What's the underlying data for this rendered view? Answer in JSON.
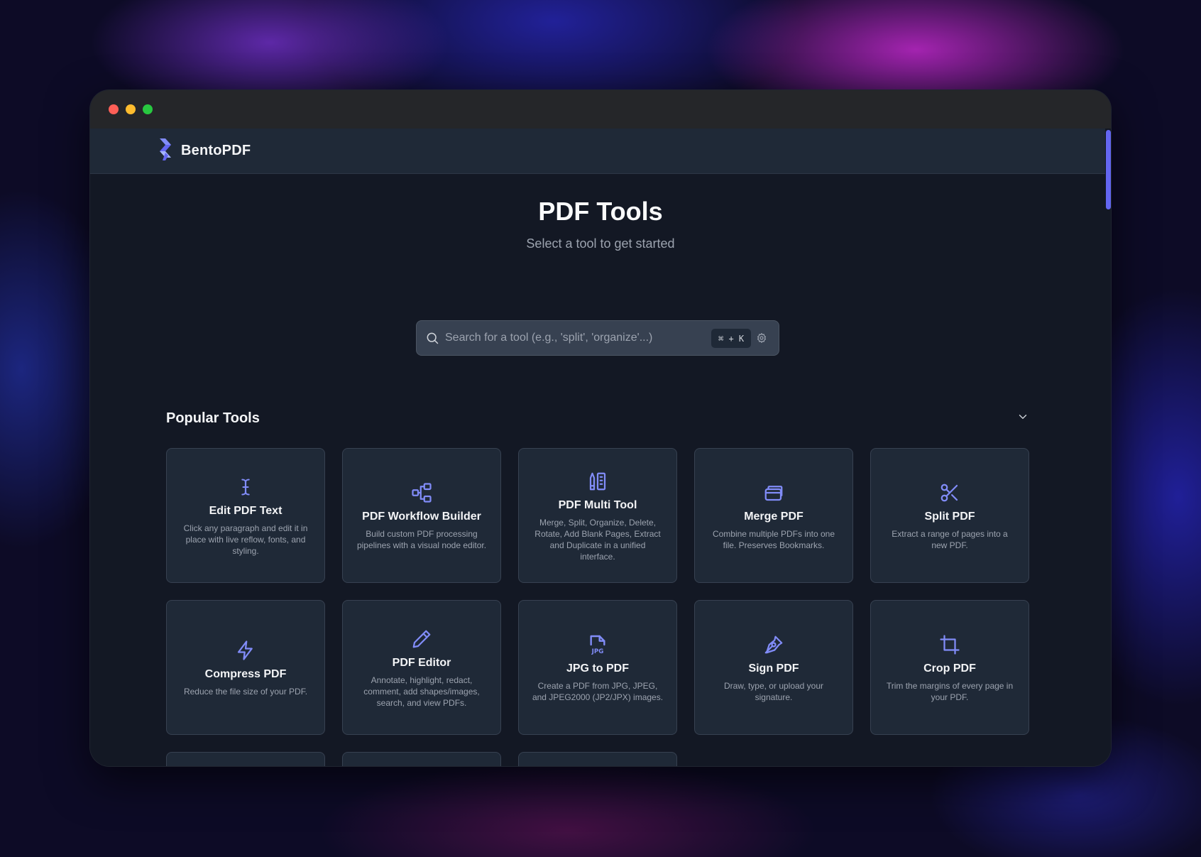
{
  "brand": {
    "name": "BentoPDF"
  },
  "hero": {
    "title": "PDF Tools",
    "subtitle": "Select a tool to get started"
  },
  "search": {
    "placeholder": "Search for a tool (e.g., 'split', 'organize'...)",
    "value": "",
    "shortcut": "⌘ + K"
  },
  "section": {
    "title": "Popular Tools"
  },
  "tools": [
    {
      "icon": "text-cursor-icon",
      "title": "Edit PDF Text",
      "desc": "Click any paragraph and edit it in place with live reflow, fonts, and styling."
    },
    {
      "icon": "workflow-icon",
      "title": "PDF Workflow Builder",
      "desc": "Build custom PDF processing pipelines with a visual node editor."
    },
    {
      "icon": "pencil-ruler-icon",
      "title": "PDF Multi Tool",
      "desc": "Merge, Split, Organize, Delete, Rotate, Add Blank Pages, Extract and Duplicate in a unified interface."
    },
    {
      "icon": "copy-stack-icon",
      "title": "Merge PDF",
      "desc": "Combine multiple PDFs into one file. Preserves Bookmarks."
    },
    {
      "icon": "scissors-icon",
      "title": "Split PDF",
      "desc": "Extract a range of pages into a new PDF."
    },
    {
      "icon": "lightning-icon",
      "title": "Compress PDF",
      "desc": "Reduce the file size of your PDF."
    },
    {
      "icon": "pencil-icon",
      "title": "PDF Editor",
      "desc": "Annotate, highlight, redact, comment, add shapes/images, search, and view PDFs."
    },
    {
      "icon": "jpg-file-icon",
      "title": "JPG to PDF",
      "desc": "Create a PDF from JPG, JPEG, and JPEG2000 (JP2/JPX) images."
    },
    {
      "icon": "pen-nib-icon",
      "title": "Sign PDF",
      "desc": "Draw, type, or upload your signature."
    },
    {
      "icon": "crop-icon",
      "title": "Crop PDF",
      "desc": "Trim the margins of every page in your PDF."
    }
  ],
  "partial_tools": [
    {
      "icon": "grid-icon"
    },
    {
      "icon": "files-icon"
    },
    {
      "icon": "trash-icon"
    }
  ]
}
